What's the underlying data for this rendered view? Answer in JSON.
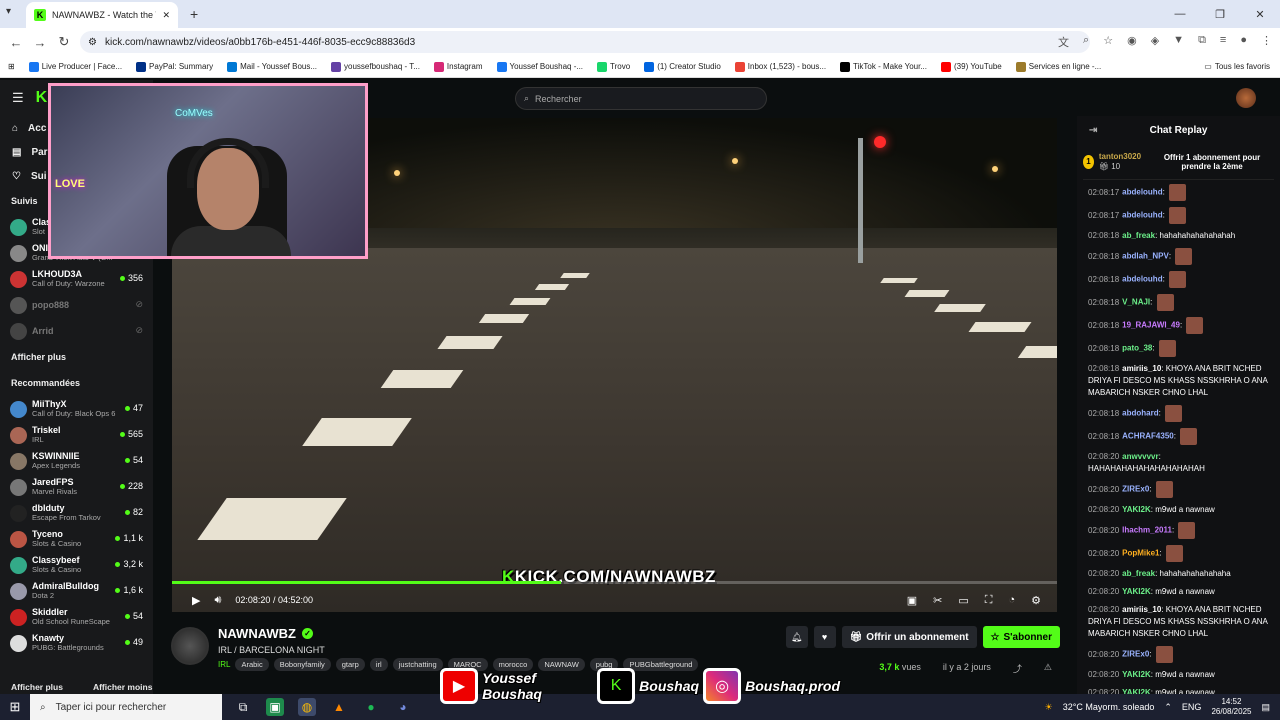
{
  "browser": {
    "tab_title": "NAWNAWBZ - Watch the VOD",
    "url": "kick.com/nawnawbz/videos/a0bb176b-e451-446f-8035-ecc9c88836d3",
    "bookmarks": [
      {
        "label": "Live Producer | Face...",
        "color": "#1877f2"
      },
      {
        "label": "PayPal: Summary",
        "color": "#003087"
      },
      {
        "label": "Mail - Youssef Bous...",
        "color": "#0078d4"
      },
      {
        "label": "youssefboushaq - T...",
        "color": "#6441a5"
      },
      {
        "label": "Instagram",
        "color": "#d62976"
      },
      {
        "label": "Youssef Boushaq -...",
        "color": "#1877f2"
      },
      {
        "label": "Trovo",
        "color": "#19d66b"
      },
      {
        "label": "(1) Creator Studio",
        "color": "#0064e0"
      },
      {
        "label": "Inbox (1,523) - bous...",
        "color": "#ea4335"
      },
      {
        "label": "TikTok - Make Your...",
        "color": "#000000"
      },
      {
        "label": "(39) YouTube",
        "color": "#ff0000"
      },
      {
        "label": "Services en ligne -...",
        "color": "#9c7b2b"
      }
    ],
    "all_favorites": "Tous les favoris"
  },
  "header": {
    "search_placeholder": "Rechercher"
  },
  "sidebar": {
    "nav": [
      {
        "label": "Acc",
        "icon": "home-icon"
      },
      {
        "label": "Par",
        "icon": "browse-icon"
      },
      {
        "label": "Sui",
        "icon": "heart-icon"
      }
    ],
    "following_title": "Suivis",
    "following": [
      {
        "name": "Clas",
        "game": "Slot",
        "viewers": "",
        "color": "#3a8"
      },
      {
        "name": "ONIGIRI78",
        "game": "Grand Theft Auto V (G...",
        "viewers": "578",
        "color": "#888"
      },
      {
        "name": "LKHOUD3A",
        "game": "Call of Duty: Warzone",
        "viewers": "356",
        "color": "#c33"
      },
      {
        "name": "popo888",
        "game": "",
        "viewers": "",
        "color": "#555",
        "offline": true
      },
      {
        "name": "Arrid",
        "game": "",
        "viewers": "",
        "color": "#444",
        "offline": true
      }
    ],
    "show_more": "Afficher plus",
    "recommended_title": "Recommandées",
    "recommended": [
      {
        "name": "MiiThyX",
        "game": "Call of Duty: Black Ops 6",
        "viewers": "47",
        "color": "#48c"
      },
      {
        "name": "Triskel",
        "game": "IRL",
        "viewers": "565",
        "color": "#a65"
      },
      {
        "name": "KSWINNIIE",
        "game": "Apex Legends",
        "viewers": "54",
        "color": "#876"
      },
      {
        "name": "JaredFPS",
        "game": "Marvel Rivals",
        "viewers": "228",
        "color": "#777"
      },
      {
        "name": "dblduty",
        "game": "Escape From Tarkov",
        "viewers": "82",
        "color": "#222"
      },
      {
        "name": "Tyceno",
        "game": "Slots & Casino",
        "viewers": "1,1 k",
        "color": "#b54"
      },
      {
        "name": "Classybeef",
        "game": "Slots & Casino",
        "viewers": "3,2 k",
        "color": "#3a8"
      },
      {
        "name": "AdmiralBulldog",
        "game": "Dota 2",
        "viewers": "1,6 k",
        "color": "#99a"
      },
      {
        "name": "Skiddler",
        "game": "Old School RuneScape",
        "viewers": "54",
        "color": "#c22"
      },
      {
        "name": "Knawty",
        "game": "PUBG: Battlegrounds",
        "viewers": "49",
        "color": "#ddd"
      }
    ],
    "footer_more": "Afficher plus",
    "footer_less": "Afficher moins"
  },
  "player": {
    "watermark": "KICK.COM/NAWNAWBZ",
    "current_time": "02:08:20",
    "duration": "04:52:00",
    "progress_fraction": 0.439,
    "webcam_neon_1": "CoMVes",
    "webcam_neon_2": "LOVE"
  },
  "channel": {
    "name": "NAWNAWBZ",
    "title": "IRL / BARCELONA NIGHT",
    "category": "IRL",
    "tags": [
      "Arabic",
      "Bobonyfamily",
      "gtarp",
      "irl",
      "justchatting",
      "MAROC",
      "morocco",
      "NAWNAW",
      "pubg",
      "PUBGbattleground"
    ],
    "subscribe_offer": "Offrir un abonnement",
    "follow": "S'abonner",
    "views_count": "3,7 k",
    "views_label": "vues",
    "age": "il y a 2 jours"
  },
  "promo": {
    "youtube": "Youssef Boushaq",
    "kick": "Boushaq",
    "instagram": "Boushaq.prod"
  },
  "chat": {
    "title": "Chat Replay",
    "pinned_user": "tanton3020",
    "pinned_count": "10",
    "pinned_rank": "1",
    "pinned_offer": "Offrir 1 abonnement pour prendre la 2ème",
    "messages": [
      {
        "t": "02:08:17",
        "u": "abdelouhd",
        "c": "#9ab3ff",
        "text": "",
        "emote": true
      },
      {
        "t": "02:08:17",
        "u": "abdelouhd",
        "c": "#9ab3ff",
        "text": "",
        "emote": true
      },
      {
        "t": "02:08:18",
        "u": "ab_freak",
        "c": "#6cf08a",
        "text": "hahahahahahahahah",
        "emote": false
      },
      {
        "t": "02:08:18",
        "u": "abdlah_NPV",
        "c": "#9ab3ff",
        "text": "",
        "emote": true
      },
      {
        "t": "02:08:18",
        "u": "abdelouhd",
        "c": "#9ab3ff",
        "text": "",
        "emote": true
      },
      {
        "t": "02:08:18",
        "u": "V_NAJI",
        "c": "#6cf08a",
        "text": "",
        "emote": true
      },
      {
        "t": "02:08:18",
        "u": "19_RAJAWI_49",
        "c": "#c87bff",
        "text": "",
        "emote": true
      },
      {
        "t": "02:08:18",
        "u": "pato_38",
        "c": "#6cf08a",
        "text": "",
        "emote": true
      },
      {
        "t": "02:08:18",
        "u": "amiriis_10",
        "c": "#fff",
        "text": "KHOYA ANA BRIT NCHED DRIYA FI DESCO MS KHASS NSSKHRHA O ANA MABARICH NSKER CHNO LHAL",
        "emote": false
      },
      {
        "t": "02:08:18",
        "u": "abdohard",
        "c": "#9ab3ff",
        "text": "",
        "emote": true
      },
      {
        "t": "02:08:18",
        "u": "ACHRAF4350",
        "c": "#9ab3ff",
        "text": "",
        "emote": true
      },
      {
        "t": "02:08:20",
        "u": "anwvvvvr",
        "c": "#6cf08a",
        "text": "HAHAHAHAHAHAHAHAHAHAH",
        "emote": false
      },
      {
        "t": "02:08:20",
        "u": "ZIREx0",
        "c": "#9ab3ff",
        "text": "",
        "emote": true
      },
      {
        "t": "02:08:20",
        "u": "YAKI2K",
        "c": "#6cf08a",
        "text": "m9wd a nawnaw",
        "emote": false
      },
      {
        "t": "02:08:20",
        "u": "lhachm_2011",
        "c": "#c87bff",
        "text": "",
        "emote": true
      },
      {
        "t": "02:08:20",
        "u": "PopMike1",
        "c": "#ffb020",
        "text": "",
        "emote": true
      },
      {
        "t": "02:08:20",
        "u": "ab_freak",
        "c": "#6cf08a",
        "text": "hahahahahahahaha",
        "emote": false
      },
      {
        "t": "02:08:20",
        "u": "YAKI2K",
        "c": "#6cf08a",
        "text": "m9wd a nawnaw",
        "emote": false
      },
      {
        "t": "02:08:20",
        "u": "amiriis_10",
        "c": "#fff",
        "text": "KHOYA ANA BRIT NCHED DRIYA FI DESCO MS KHASS NSSKHRHA O ANA MABARICH NSKER CHNO LHAL",
        "emote": false
      },
      {
        "t": "02:08:20",
        "u": "ZIREx0",
        "c": "#9ab3ff",
        "text": "",
        "emote": true
      },
      {
        "t": "02:08:20",
        "u": "YAKI2K",
        "c": "#6cf08a",
        "text": "m9wd a nawnaw",
        "emote": false
      },
      {
        "t": "02:08:20",
        "u": "YAKI2K",
        "c": "#6cf08a",
        "text": "m9wd a nawnaw",
        "emote": false
      }
    ]
  },
  "taskbar": {
    "search_placeholder": "Taper ici pour rechercher",
    "weather": "32°C  Mayorm. soleado",
    "lang": "ENG",
    "time": "14:52",
    "date": "26/08/2025"
  }
}
